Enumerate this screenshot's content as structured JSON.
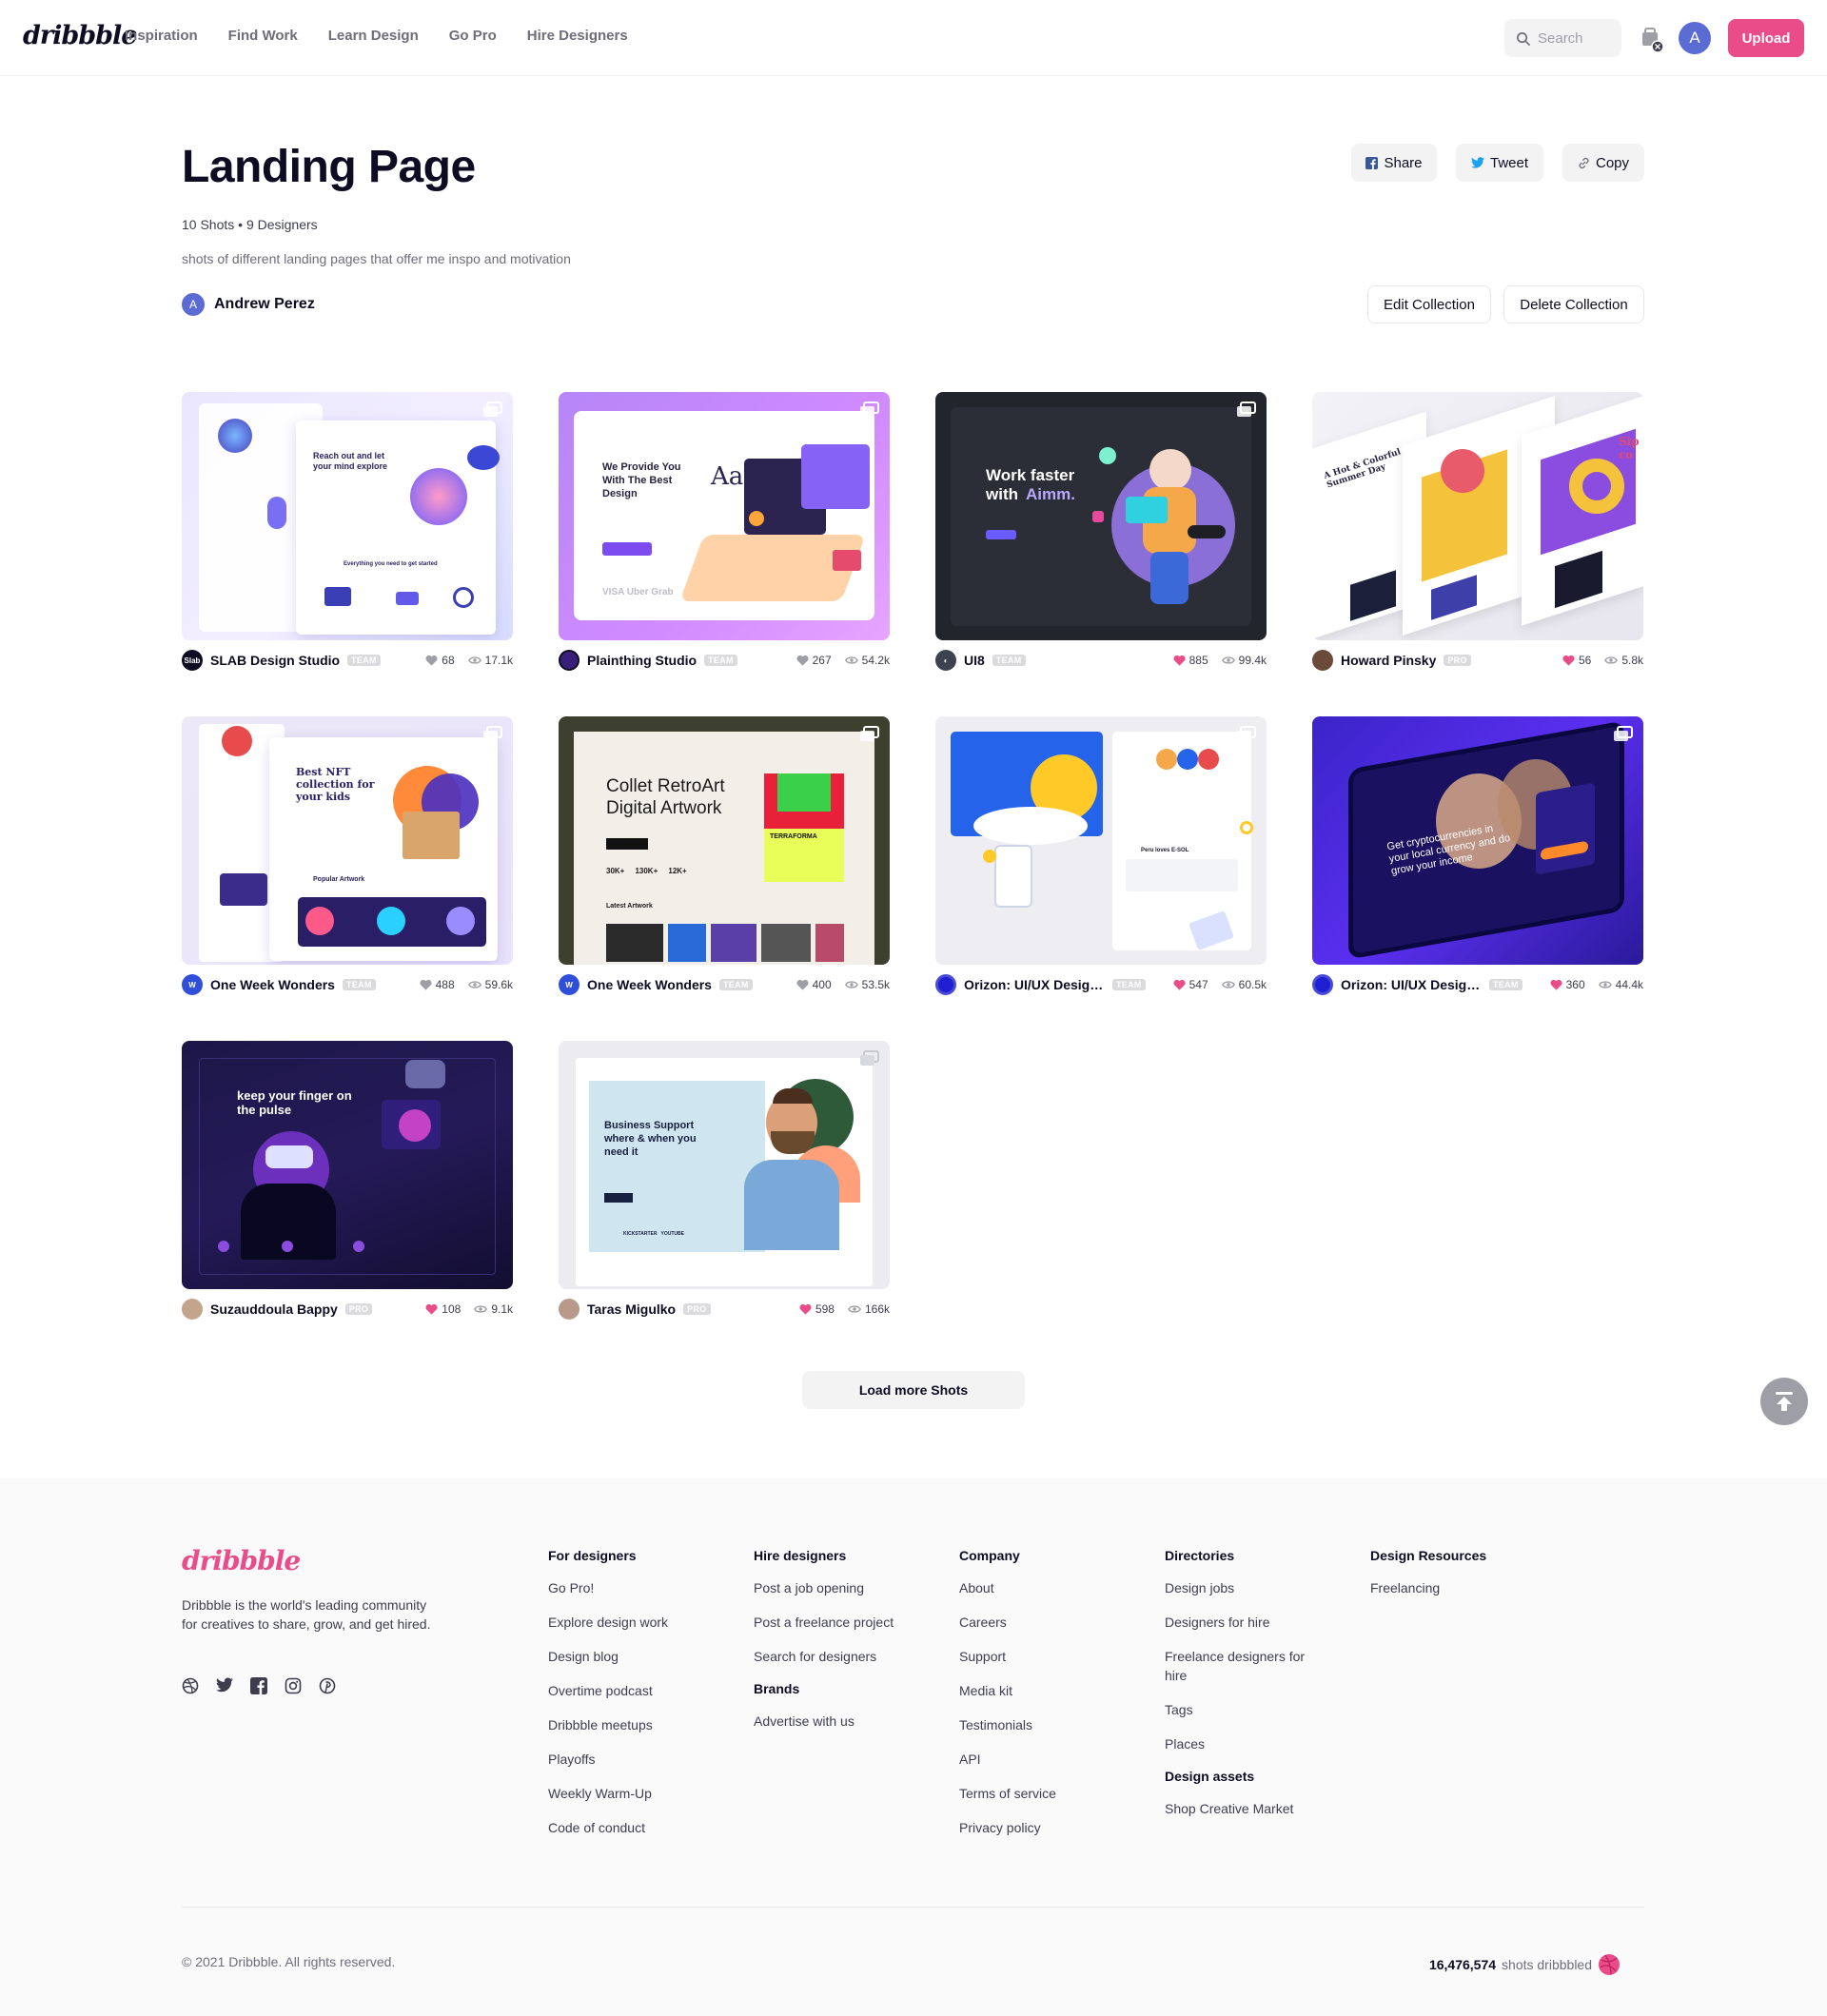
{
  "header": {
    "logo": "dribbble",
    "nav": [
      "Inspiration",
      "Find Work",
      "Learn Design",
      "Go Pro",
      "Hire Designers"
    ],
    "search_placeholder": "Search",
    "avatar_initial": "A",
    "upload_label": "Upload"
  },
  "collection": {
    "title": "Landing Page",
    "counts": "10 Shots • 9 Designers",
    "description": "shots of different landing pages that offer me inspo and motivation",
    "owner_initial": "A",
    "owner_name": "Andrew Perez",
    "share_label": "Share",
    "tweet_label": "Tweet",
    "copy_label": "Copy",
    "edit_label": "Edit Collection",
    "delete_label": "Delete Collection"
  },
  "shots": [
    {
      "designer": "SLAB Design Studio",
      "badge": "TEAM",
      "likes": "68",
      "views": "17.1k",
      "liked": false
    },
    {
      "designer": "Plainthing Studio",
      "badge": "TEAM",
      "likes": "267",
      "views": "54.2k",
      "liked": false
    },
    {
      "designer": "UI8",
      "badge": "TEAM",
      "likes": "885",
      "views": "99.4k",
      "liked": true
    },
    {
      "designer": "Howard Pinsky",
      "badge": "PRO",
      "likes": "56",
      "views": "5.8k",
      "liked": true
    },
    {
      "designer": "One Week Wonders",
      "badge": "TEAM",
      "likes": "488",
      "views": "59.6k",
      "liked": false
    },
    {
      "designer": "One Week Wonders",
      "badge": "TEAM",
      "likes": "400",
      "views": "53.5k",
      "liked": false
    },
    {
      "designer": "Orizon: UI/UX Design A...",
      "badge": "TEAM",
      "likes": "547",
      "views": "60.5k",
      "liked": true
    },
    {
      "designer": "Orizon: UI/UX Design ...",
      "badge": "TEAM",
      "likes": "360",
      "views": "44.4k",
      "liked": true
    },
    {
      "designer": "Suzauddoula Bappy",
      "badge": "PRO",
      "likes": "108",
      "views": "9.1k",
      "liked": true
    },
    {
      "designer": "Taras Migulko",
      "badge": "PRO",
      "likes": "598",
      "views": "166k",
      "liked": true
    }
  ],
  "thumbs": {
    "t1_heading": "Reach out and let your mind explore",
    "t1_sub": "Everything you need to get started",
    "t2_heading": "We Provide You With The Best Design",
    "t2_logos": "VISA   Uber   Grab",
    "t3_heading": "Work faster with",
    "t3_brand": "Aimm.",
    "t4_heading": "A Hot & Colorful Summer Day",
    "t5_heading": "Best NFT collection for your kids",
    "t5_sub": "Popular Artwork",
    "t6_heading": "Collet RetroArt Digital Artwork",
    "t6_stats": "30K+     130K+     12K+",
    "t6_sub": "Latest Artwork",
    "t6_tag": "TERRAFORMA",
    "t7_heading": "Peru loves E-SOL",
    "t8_heading": "Get cryptocurrencies in your local currency and do grow your income",
    "t9_heading": "Keep your finger on the pulse",
    "t10_heading": "Business Support where & when you need it",
    "t10_logos": "KICKSTARTER   YOUTUBE"
  },
  "load_more_label": "Load more Shots",
  "footer": {
    "logo": "dribbble",
    "tagline": "Dribbble is the world's leading community for creatives to share, grow, and get hired.",
    "columns": [
      {
        "title": "For designers",
        "links": [
          "Go Pro!",
          "Explore design work",
          "Design blog",
          "Overtime podcast",
          "Dribbble meetups",
          "Playoffs",
          "Weekly Warm-Up",
          "Code of conduct"
        ]
      },
      {
        "title": "Hire designers",
        "links": [
          "Post a job opening",
          "Post a freelance project",
          "Search for designers"
        ],
        "sub_title": "Brands",
        "sub_links": [
          "Advertise with us"
        ]
      },
      {
        "title": "Company",
        "links": [
          "About",
          "Careers",
          "Support",
          "Media kit",
          "Testimonials",
          "API",
          "Terms of service",
          "Privacy policy"
        ]
      },
      {
        "title": "Directories",
        "links": [
          "Design jobs",
          "Designers for hire",
          "Freelance designers for hire",
          "Tags",
          "Places"
        ],
        "sub_title": "Design assets",
        "sub_links": [
          "Shop Creative Market"
        ]
      },
      {
        "title": "Design Resources",
        "links": [
          "Freelancing"
        ]
      }
    ],
    "copyright": "© 2021 Dribbble. All rights reserved.",
    "shots_count": "16,476,574",
    "shots_suffix": "shots dribbbled"
  },
  "colors": {
    "brand_pink": "#ea4c89",
    "text_dark": "#0d0c22",
    "text_muted": "#6e6d7a"
  }
}
